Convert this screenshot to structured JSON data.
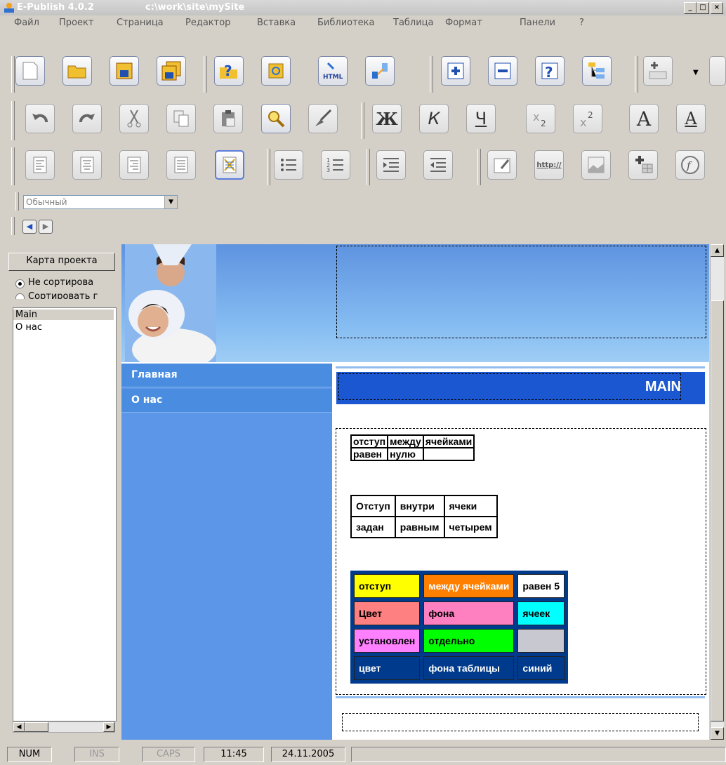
{
  "window": {
    "app_title": "E-Publish 4.0.2",
    "path": "c:\\work\\site\\mySite"
  },
  "menu": [
    "Файл",
    "Проект",
    "Страница",
    "Редактор",
    "Вставка",
    "Библиотека",
    "Таблица",
    "Формат",
    "Панели",
    "?"
  ],
  "toolbar": {
    "bold_glyph": "Ж",
    "italic_glyph": "К",
    "underline_glyph": "Ч",
    "font_glyph": "A",
    "link_text": "http://"
  },
  "style_combo": {
    "value": "Обычный"
  },
  "left_panel": {
    "map_button": "Карта проекта",
    "sort_options": [
      "Не сортирова",
      "Сортировать г"
    ],
    "pages": [
      "Main",
      "О нас"
    ]
  },
  "site": {
    "nav": [
      "Главная",
      "О нас"
    ],
    "title": "MAIN",
    "table1": [
      [
        "отступ",
        "между",
        "ячейками"
      ],
      [
        "равен",
        "нулю",
        ""
      ]
    ],
    "table2": [
      [
        "Отступ",
        "внутри",
        "ячеки"
      ],
      [
        "задан",
        "равным",
        "четырем"
      ]
    ],
    "table3": [
      [
        {
          "text": "отступ",
          "bg": "#ffff00",
          "fg": "#000000"
        },
        {
          "text": "между ячейками",
          "bg": "#ff8000",
          "fg": "#ffffff"
        },
        {
          "text": "равен 5",
          "bg": "#ffffff",
          "fg": "#000000"
        }
      ],
      [
        {
          "text": "Цвет",
          "bg": "#ff8080",
          "fg": "#000000"
        },
        {
          "text": "фона",
          "bg": "#ff80c0",
          "fg": "#000000"
        },
        {
          "text": "ячеек",
          "bg": "#00ffff",
          "fg": "#000000"
        }
      ],
      [
        {
          "text": "установлен",
          "bg": "#ff80ff",
          "fg": "#000000"
        },
        {
          "text": "отдельно",
          "bg": "#00ff00",
          "fg": "#000000"
        },
        {
          "text": "",
          "bg": "#c8c8d0",
          "fg": "#000000"
        }
      ],
      [
        {
          "text": "цвет",
          "bg": "#003a8c",
          "fg": "#ffffff"
        },
        {
          "text": "фона таблицы",
          "bg": "#003a8c",
          "fg": "#ffffff"
        },
        {
          "text": "синий",
          "bg": "#003a8c",
          "fg": "#ffffff"
        }
      ]
    ]
  },
  "status": {
    "num": "NUM",
    "ins": "INS",
    "caps": "CAPS",
    "time": "11:45",
    "date": "24.11.2005"
  }
}
